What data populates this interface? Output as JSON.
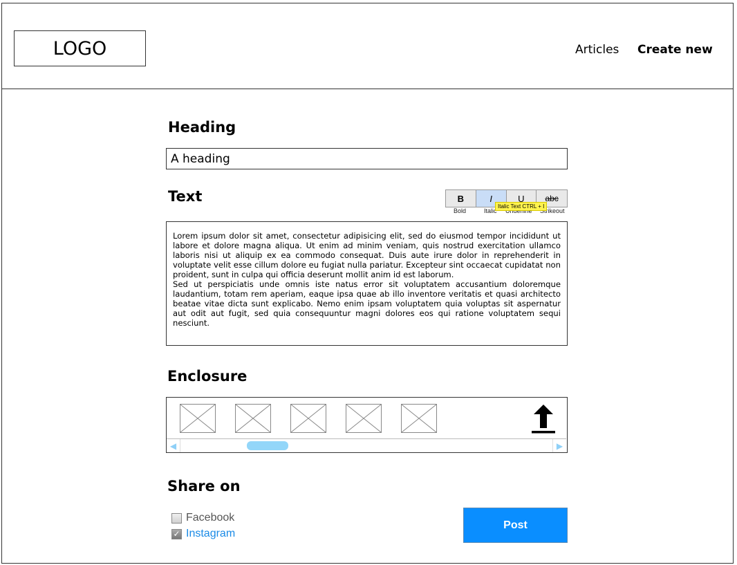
{
  "header": {
    "logo": "LOGO",
    "nav": {
      "articles": "Articles",
      "create_new": "Create new"
    }
  },
  "heading_section": {
    "title": "Heading",
    "input_value": "A heading"
  },
  "text_section": {
    "title": "Text",
    "toolbar": {
      "bold": {
        "glyph": "B",
        "label": "Bold"
      },
      "italic": {
        "glyph": "I",
        "label": "Italic"
      },
      "underline": {
        "glyph": "U",
        "label": "Underline"
      },
      "strike": {
        "glyph": "abc",
        "label": "Strikeout"
      }
    },
    "tooltip": "Italic Text CTRL + I",
    "body": "Lorem ipsum dolor sit amet, consectetur adipisicing elit, sed do eiusmod tempor incididunt ut labore et dolore magna aliqua. Ut enim ad minim veniam, quis nostrud exercitation ullamco laboris nisi ut aliquip ex ea commodo consequat. Duis aute irure dolor in reprehenderit in voluptate velit esse cillum dolore eu fugiat nulla pariatur. Excepteur sint occaecat cupidatat non proident, sunt in culpa qui officia deserunt mollit anim id est laborum.\nSed ut perspiciatis unde omnis iste natus error sit voluptatem accusantium doloremque laudantium, totam rem aperiam, eaque ipsa quae ab illo inventore veritatis et quasi architecto beatae vitae dicta sunt explicabo. Nemo enim ipsam voluptatem quia voluptas sit aspernatur aut odit aut fugit, sed quia consequuntur magni dolores eos qui ratione voluptatem sequi nesciunt."
  },
  "enclosure_section": {
    "title": "Enclosure",
    "thumbnails": [
      "image-placeholder-icon",
      "image-placeholder-icon",
      "image-placeholder-icon",
      "image-placeholder-icon",
      "image-placeholder-icon"
    ],
    "upload_icon": "upload-icon",
    "scroll_left": "◀",
    "scroll_right": "▶"
  },
  "share_section": {
    "title": "Share on",
    "options": [
      {
        "label": "Facebook",
        "checked": false
      },
      {
        "label": "Instagram",
        "checked": true
      }
    ],
    "checkmark": "✓",
    "post_button": "Post"
  },
  "colors": {
    "post_button": "#0a8eff",
    "instagram_link": "#1a8ae6",
    "scroll_thumb": "#93d6f9",
    "tooltip": "#fff34d",
    "active_tool": "#c9ddf7"
  }
}
